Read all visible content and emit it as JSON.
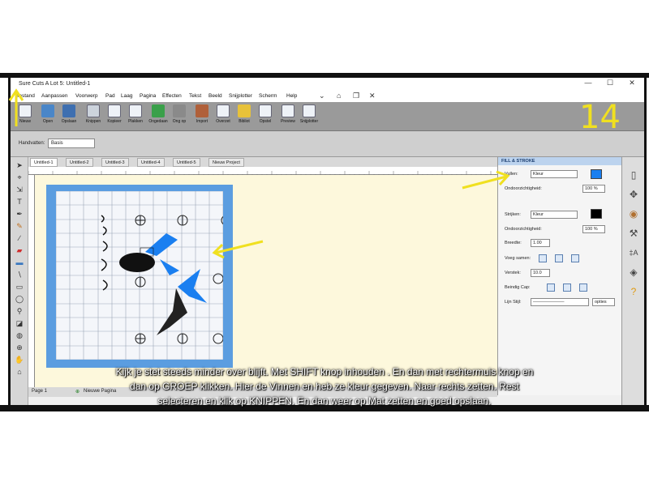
{
  "window": {
    "title": "Sure Cuts A Lot 5: Untitled-1",
    "minimize": "—",
    "maximize": "☐",
    "close": "✕"
  },
  "menu": [
    "Bestand",
    "Aanpassen",
    "Voorwerp",
    "Pad",
    "Laag",
    "Pagina",
    "Effecten",
    "Tekst",
    "Beeld",
    "Snijplotter",
    "Scherm",
    "Help"
  ],
  "toolbar": [
    "Nieuw",
    "Open",
    "Opslaan",
    "Knippen",
    "Kopieer",
    "Plakken",
    "Ongedaan",
    "Ong op",
    "Import",
    "Overzet",
    "Bibliot",
    "Opstel",
    "Preview",
    "Snijplotter"
  ],
  "subbar": {
    "label": "Handvatten:",
    "value": "Basis"
  },
  "tabs": [
    "Untitled-1",
    "Untitled-2",
    "Untitled-3",
    "Untitled-4",
    "Untitled-5",
    "Nieuw Project"
  ],
  "pagebar": {
    "page": "Page 1",
    "new_page": "Nieuwe Pagina"
  },
  "fill_stroke": {
    "header": "FILL & STROKE",
    "fill_label": "Vullen:",
    "fill_value": "Kleur",
    "fill_color": "#1a7ff0",
    "opacity_label": "Ondoorzichtigheid:",
    "opacity_value": "100 %",
    "stroke_label": "Strijken:",
    "stroke_value": "Kleur",
    "stroke_color": "#000000",
    "stroke_opacity_label": "Ondoorzichtigheid:",
    "stroke_opacity_value": "100 %",
    "width_label": "Breedte:",
    "width_value": "1.00",
    "join_label": "Voeg samen:",
    "spacing_label": "Verstek:",
    "spacing_value": "10.0",
    "cap_label": "Beindig Cap:",
    "line_style_label": "Lijn Stijl:",
    "options_label": "opties"
  },
  "step_number": "14",
  "subtitle": [
    "Kijk je stet steeds minder over blijft. Met SHIFT  knop inhouden . En dan met rechtermuis knop en",
    "dan op GROEP klikken. Hier de Vinnen en heb ze kleur gegeven. Naar rechts zetten. Rest",
    "selecteren en klik op KNIPPEN.  En dan weer op Mat zetten en goed opslaan."
  ],
  "colors": {
    "accent": "#1a7ff0",
    "mat": "#5b9de0",
    "canvas": "#fdf8dc",
    "annotation": "#f0e020"
  }
}
